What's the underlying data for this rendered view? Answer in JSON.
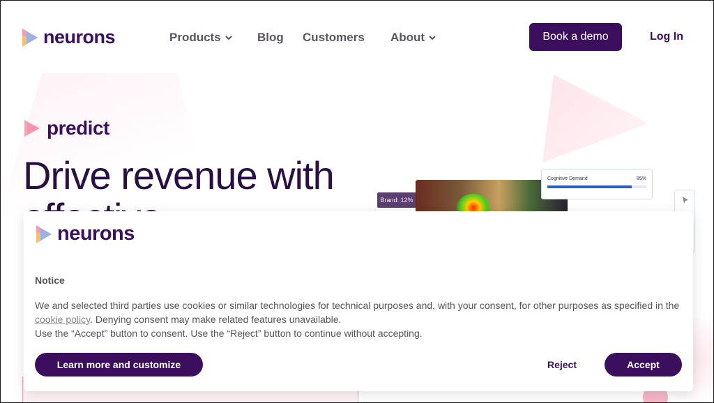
{
  "header": {
    "logo_text": "neurons",
    "nav": [
      {
        "label": "Products",
        "has_dropdown": true
      },
      {
        "label": "Blog",
        "has_dropdown": false
      },
      {
        "label": "Customers",
        "has_dropdown": false
      },
      {
        "label": "About",
        "has_dropdown": true
      }
    ],
    "demo_label": "Book a demo",
    "login_label": "Log In"
  },
  "hero": {
    "product_name": "predict",
    "title": "Drive revenue with effective",
    "brand_tag": "Brand: 12%",
    "cognitive_label": "Cognitive Demand",
    "cognitive_value": "85%",
    "cognitive_level": 0.85
  },
  "cookie": {
    "logo_text": "neurons",
    "heading": "Notice",
    "body_before_link": "We and selected third parties use cookies or similar technologies for technical purposes and, with your consent, for other purposes as specified in the ",
    "link_text": "cookie policy",
    "body_after_link": ". Denying consent may make related features unavailable.",
    "body_line2": "Use the “Accept” button to consent. Use the “Reject” button to continue without accepting.",
    "learn_more_label": "Learn more and customize",
    "reject_label": "Reject",
    "accept_label": "Accept"
  },
  "colors": {
    "brand": "#3b0f5e",
    "text_muted": "#555555",
    "accent_pink": "#f7b6c5"
  }
}
